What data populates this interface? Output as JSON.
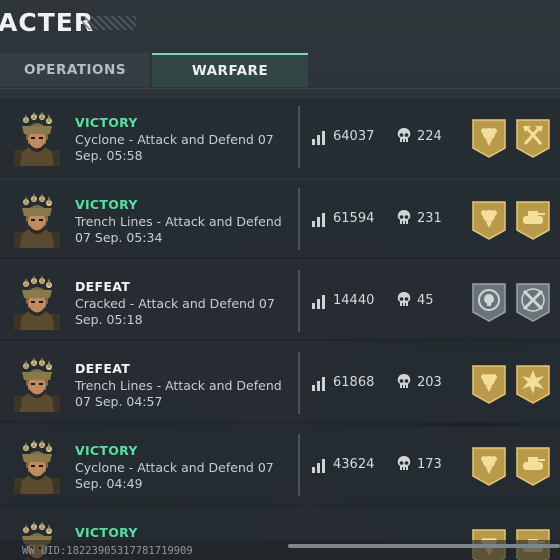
{
  "header": {
    "title": "ACTER"
  },
  "tabs": [
    {
      "label": "OPERATIONS",
      "active": false
    },
    {
      "label": "WARFARE",
      "active": true
    }
  ],
  "matches": [
    {
      "result": "VICTORY",
      "outcome": "win",
      "mode": "Cyclone - Attack and Defend",
      "time": "07 Sep. 05:58",
      "score": "64037",
      "kills": "224",
      "badges": [
        "rose-medal-icon",
        "axes-medal-icon"
      ]
    },
    {
      "result": "VICTORY",
      "outcome": "win",
      "mode": "Trench Lines - Attack and Defend",
      "time": "07 Sep. 05:34",
      "score": "61594",
      "kills": "231",
      "badges": [
        "rose-medal-icon",
        "tank-medal-icon"
      ]
    },
    {
      "result": "DEFEAT",
      "outcome": "lose",
      "mode": "Cracked - Attack and Defend",
      "time": "07 Sep. 05:18",
      "score": "14440",
      "kills": "45",
      "badges": [
        "skull-target-medal-icon",
        "crossed-tools-medal-icon"
      ]
    },
    {
      "result": "DEFEAT",
      "outcome": "lose",
      "mode": "Trench Lines - Attack and Defend",
      "time": "07 Sep. 04:57",
      "score": "61868",
      "kills": "203",
      "badges": [
        "rose-medal-icon",
        "explosion-medal-icon"
      ]
    },
    {
      "result": "VICTORY",
      "outcome": "win",
      "mode": "Cyclone - Attack and Defend",
      "time": "07 Sep. 04:49",
      "score": "43624",
      "kills": "173",
      "badges": [
        "rose-medal-icon",
        "tank-medal-icon"
      ]
    },
    {
      "result": "VICTORY",
      "outcome": "win"
    }
  ],
  "footer": {
    "uid": "WW UID:1822390531778171990​9"
  },
  "colors": {
    "victory": "#55e0a0",
    "defeat": "#f3f4f5",
    "gold_badge": "#b99a4a",
    "silver_badge": "#6a7377",
    "tab_accent": "#7fd4b8"
  }
}
